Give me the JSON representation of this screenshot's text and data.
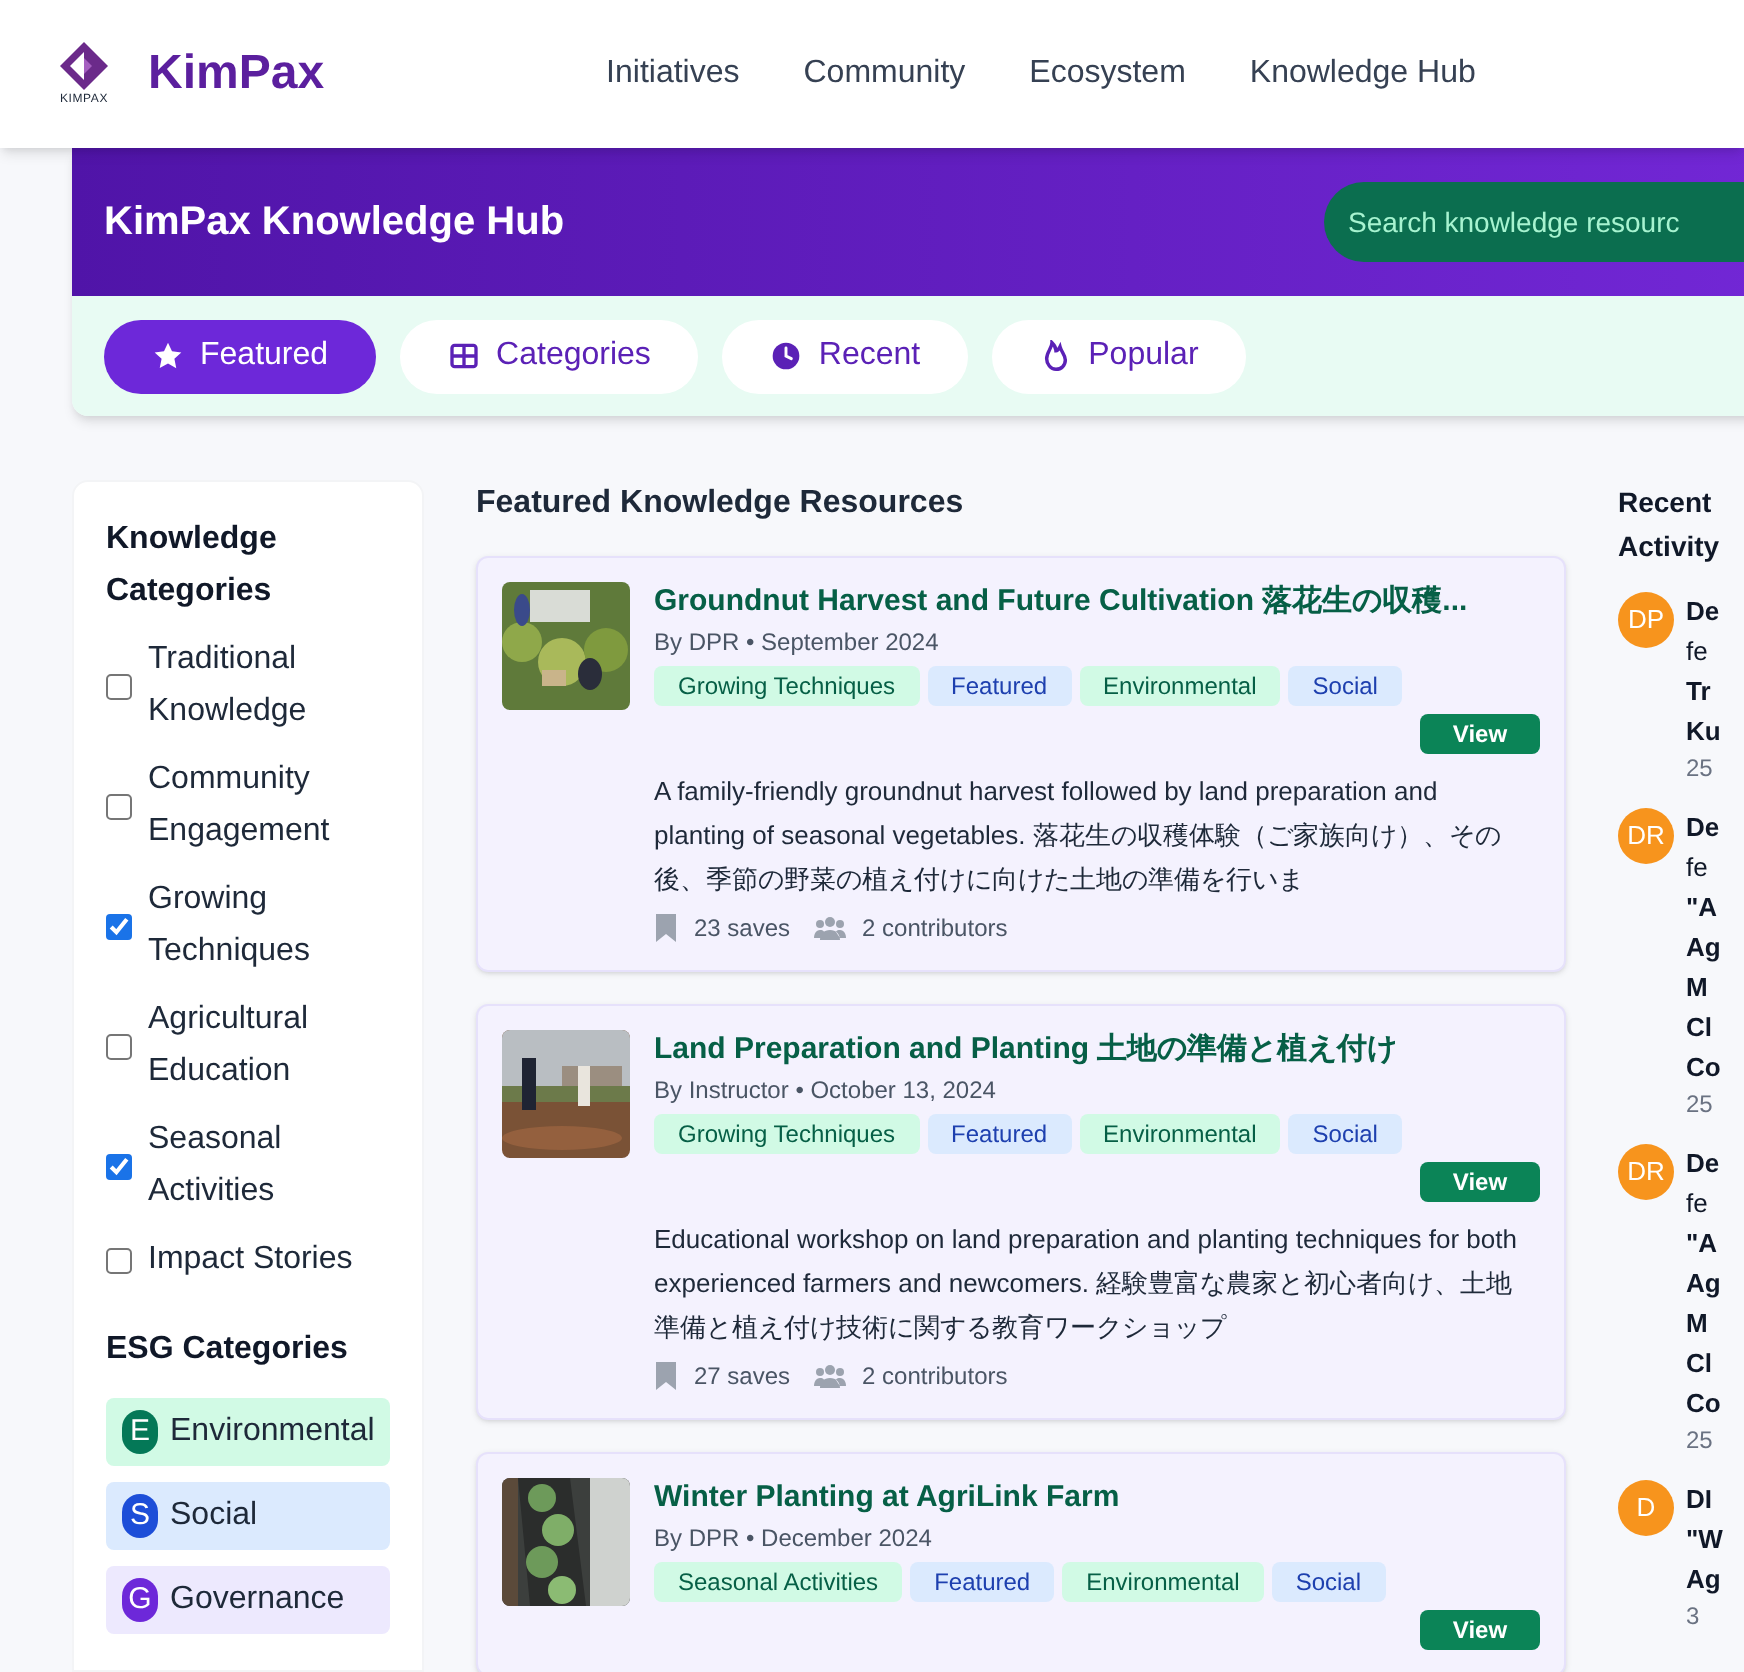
{
  "logo": {
    "mark_text": "KIMPAX",
    "brand": "KimPax"
  },
  "nav": [
    "Initiatives",
    "Community",
    "Ecosystem",
    "Knowledge Hub"
  ],
  "hero": {
    "title": "KimPax Knowledge Hub",
    "search": {
      "placeholder": "Search knowledge resourc"
    }
  },
  "tabs": [
    {
      "label": "Featured",
      "selected": true
    },
    {
      "label": "Categories",
      "selected": false
    },
    {
      "label": "Recent",
      "selected": false
    },
    {
      "label": "Popular",
      "selected": false
    }
  ],
  "sidebar": {
    "heading": "Knowledge Categories",
    "categories": [
      {
        "label": "Traditional Knowledge",
        "checked": false
      },
      {
        "label": "Community Engagement",
        "checked": false
      },
      {
        "label": "Growing Techniques",
        "checked": true
      },
      {
        "label": "Agricultural Education",
        "checked": false
      },
      {
        "label": "Seasonal Activities",
        "checked": true
      },
      {
        "label": "Impact Stories",
        "checked": false
      }
    ],
    "esg_heading": "ESG Categories",
    "esg": [
      {
        "letter": "E",
        "label": "Environmental",
        "color": "#047857"
      },
      {
        "letter": "S",
        "label": "Social",
        "color": "#1d4ed8"
      },
      {
        "letter": "G",
        "label": "Governance",
        "color": "#6d28d9"
      }
    ]
  },
  "main": {
    "heading": "Featured Knowledge Resources",
    "resources": [
      {
        "title": "Groundnut Harvest and Future Cultivation 落花生の収穫...",
        "meta": "By DPR • September 2024",
        "tags": [
          {
            "label": "Growing Techniques",
            "color": "#d1fae5"
          },
          {
            "label": "Featured",
            "color": "#dbeafe"
          },
          {
            "label": "Environmental",
            "color": "#d1fae5"
          },
          {
            "label": "Social",
            "color": "#dbeafe"
          }
        ],
        "action": "View",
        "description": "A family-friendly groundnut harvest followed by land preparation and planting of seasonal vegetables. 落花生の収穫体験（ご家族向け）、その後、季節の野菜の植え付けに向けた土地の準備を行いま",
        "saves": "23 saves",
        "contributors": "2 contributors"
      },
      {
        "title": "Land Preparation and Planting 土地の準備と植え付け",
        "meta": "By Instructor • October 13, 2024",
        "tags": [
          {
            "label": "Growing Techniques",
            "color": "#d1fae5"
          },
          {
            "label": "Featured",
            "color": "#dbeafe"
          },
          {
            "label": "Environmental",
            "color": "#d1fae5"
          },
          {
            "label": "Social",
            "color": "#dbeafe"
          }
        ],
        "action": "View",
        "description": "Educational workshop on land preparation and planting techniques for both experienced farmers and newcomers. 経験豊富な農家と初心者向け、土地準備と植え付け技術に関する教育ワークショップ",
        "saves": "27 saves",
        "contributors": "2 contributors"
      },
      {
        "title": "Winter Planting at AgriLink Farm",
        "meta": "By DPR • December 2024",
        "tags": [
          {
            "label": "Seasonal Activities",
            "color": "#d1fae5"
          },
          {
            "label": "Featured",
            "color": "#dbeafe"
          },
          {
            "label": "Environmental",
            "color": "#d1fae5"
          },
          {
            "label": "Social",
            "color": "#dbeafe"
          }
        ],
        "action": "View"
      }
    ]
  },
  "activity": {
    "heading": "Recent Activity",
    "items": [
      {
        "initials": "DP",
        "lines": [
          {
            "text": "De",
            "bold": true
          },
          {
            "text": "fe",
            "bold": false
          },
          {
            "text": "Tr",
            "bold": true
          },
          {
            "text": "Ku",
            "bold": true
          }
        ],
        "time": "25"
      },
      {
        "initials": "DR",
        "lines": [
          {
            "text": "De",
            "bold": true
          },
          {
            "text": "fe",
            "bold": false
          },
          {
            "text": "\"A",
            "bold": true
          },
          {
            "text": "Ag",
            "bold": true
          },
          {
            "text": "M",
            "bold": true
          },
          {
            "text": "Cl",
            "bold": true
          },
          {
            "text": "Co",
            "bold": true
          }
        ],
        "time": "25"
      },
      {
        "initials": "DR",
        "lines": [
          {
            "text": "De",
            "bold": true
          },
          {
            "text": "fe",
            "bold": false
          },
          {
            "text": "\"A",
            "bold": true
          },
          {
            "text": "Ag",
            "bold": true
          },
          {
            "text": "M",
            "bold": true
          },
          {
            "text": "Cl",
            "bold": true
          },
          {
            "text": "Co",
            "bold": true
          }
        ],
        "time": "25"
      },
      {
        "initials": "D",
        "lines": [
          {
            "text": "DI",
            "bold": true
          },
          {
            "text": "\"W",
            "bold": true
          },
          {
            "text": "Ag",
            "bold": true
          }
        ],
        "time": "3"
      }
    ]
  }
}
